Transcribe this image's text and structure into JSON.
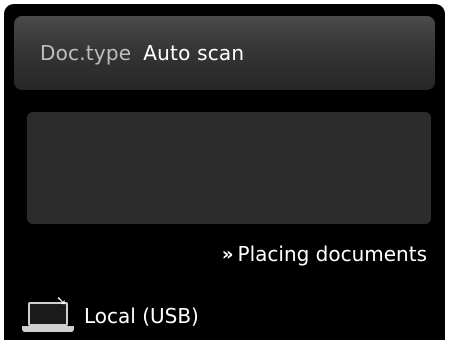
{
  "doc_type": {
    "label": "Doc.type",
    "value": "Auto scan"
  },
  "placing_link": {
    "icon": "double-chevron-right-icon",
    "label": "Placing documents"
  },
  "destination": {
    "icon": "laptop-usb-icon",
    "label": "Local (USB)"
  },
  "colors": {
    "background": "#000000",
    "bar": "#363636",
    "preview": "#2c2c2c",
    "text": "#ffffff",
    "label_text": "#bdbdbd"
  }
}
